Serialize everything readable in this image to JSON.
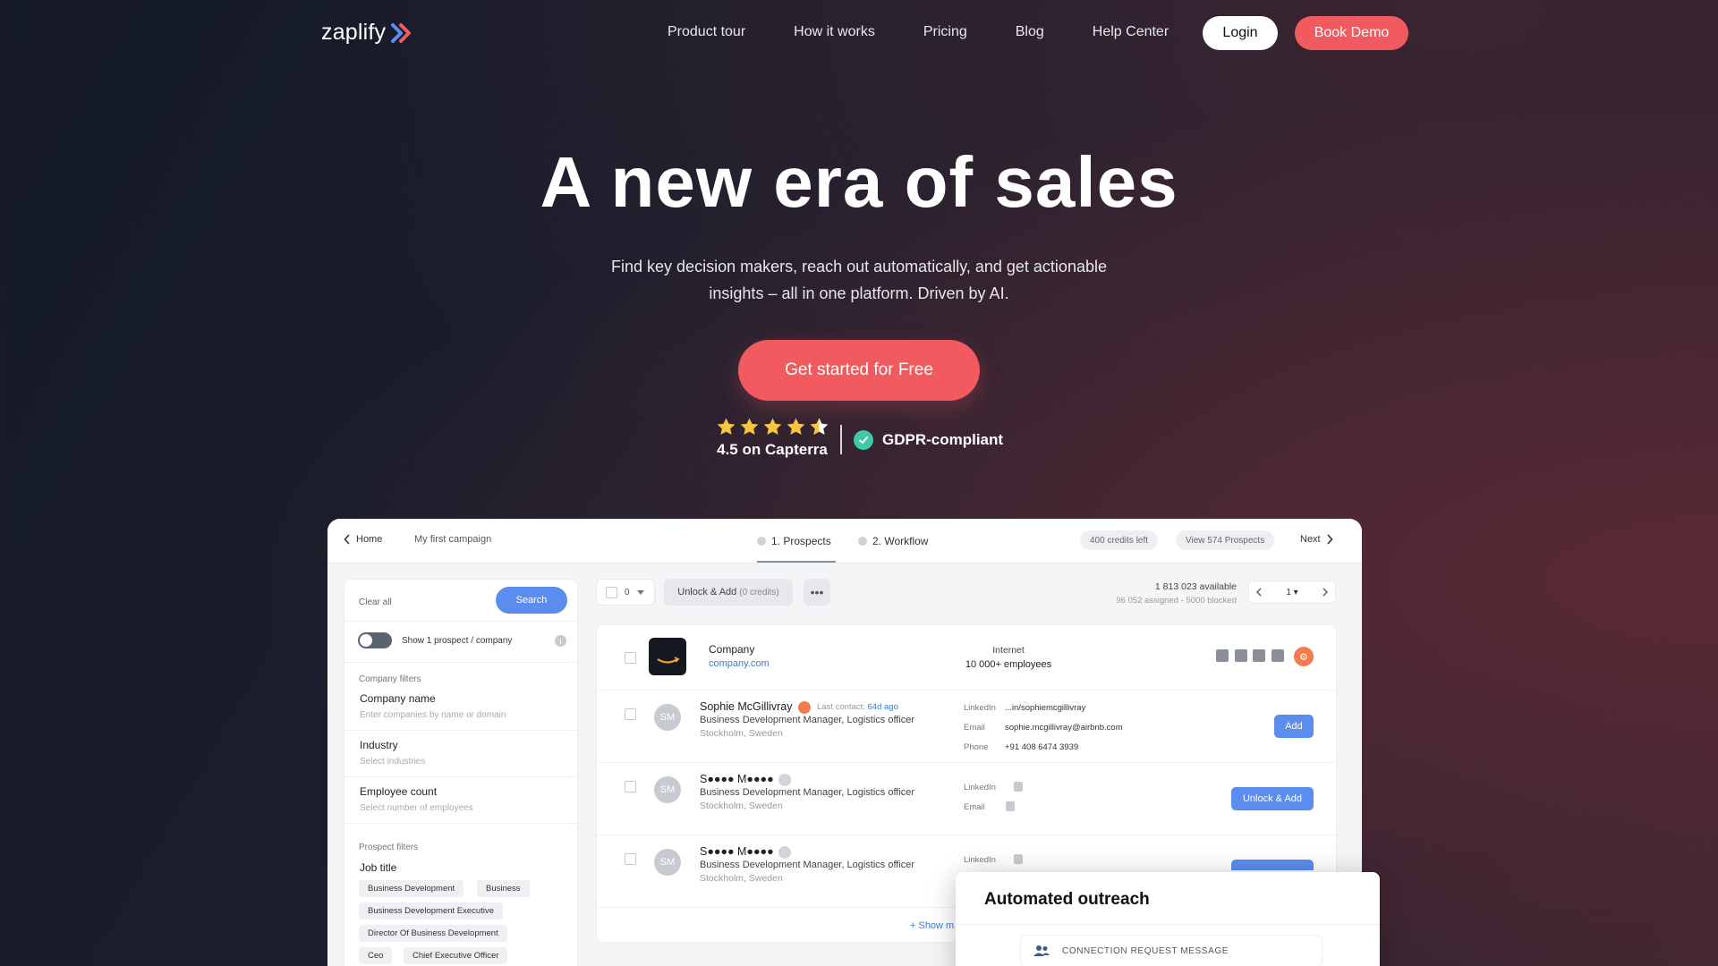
{
  "nav": {
    "logo_text": "zaplify",
    "links": [
      "Product tour",
      "How it works",
      "Pricing",
      "Blog",
      "Help Center"
    ],
    "login_label": "Login",
    "demo_label": "Book Demo"
  },
  "hero": {
    "title": "A new era of sales",
    "subtitle": "Find key decision makers, reach out automatically, and get actionable insights – all in one platform. Driven by AI.",
    "cta_label": "Get started for Free",
    "rating_value": 4.5,
    "rating_max": 5,
    "rating_text": "4.5 on Capterra",
    "gdpr_text": "GDPR-compliant"
  },
  "colors": {
    "accent": "#f15a5e",
    "blue": "#5b8def",
    "gdpr": "#3ec9a7",
    "star": "#f6c543"
  },
  "app": {
    "breadcrumb_home": "Home",
    "breadcrumb_campaign": "My first campaign",
    "step1": "1. Prospects",
    "step2": "2. Workflow",
    "credits": "400 credits left",
    "view_prospects": "View 574 Prospects",
    "next_label": "Next",
    "sidebar": {
      "clear_all": "Clear all",
      "search_label": "Search",
      "show_one": "Show 1 prospect / company",
      "company_filters": "Company filters",
      "company_name_label": "Company name",
      "company_name_ph": "Enter companies by name or domain",
      "industry_label": "Industry",
      "industry_ph": "Select industries",
      "employee_label": "Employee count",
      "employee_ph": "Select number of employees",
      "prospect_filters": "Prospect filters",
      "job_title_label": "Job title",
      "tags": [
        "Business Development",
        "Business",
        "Business Development Executive",
        "Director Of Business Development",
        "Ceo",
        "Chief Executive Officer"
      ]
    },
    "toolbar": {
      "selected_count": "0",
      "unlock_add": "Unlock & Add",
      "unlock_credits": "(0 credits)",
      "more": "•••",
      "available": "1 813 023 available",
      "assigned": "96 052 assigned - 5000 blocked",
      "page": "1"
    },
    "company_row": {
      "label": "Company",
      "link": "company.com",
      "industry": "Internet",
      "employees": "10 000+ employees"
    },
    "prospects": [
      {
        "initials": "SM",
        "name": "Sophie McGillivray",
        "last_contact_label": "Last contact:",
        "last_contact_value": "64d ago",
        "title": "Business Development Manager, Logistics officer",
        "location": "Stockholm, Sweden",
        "linkedin_key": "LinkedIn",
        "linkedin_val": "...in/sophiemcgillivray",
        "email_key": "Email",
        "email_val": "sophie.mcgillivray@airbnb.com",
        "phone_key": "Phone",
        "phone_val": "+91 408 6474 3939",
        "action": "Add"
      },
      {
        "initials": "SM",
        "name": "S●●●● M●●●●",
        "title": "Business Development Manager, Logistics officer",
        "location": "Stockholm, Sweden",
        "linkedin_key": "LinkedIn",
        "email_key": "Email",
        "action": "Unlock & Add"
      },
      {
        "initials": "SM",
        "name": "S●●●● M●●●●",
        "title": "Business Development Manager, Logistics officer",
        "location": "Stockholm, Sweden",
        "linkedin_key": "LinkedIn"
      }
    ],
    "show_more": "+ Show m"
  },
  "outreach": {
    "title": "Automated outreach",
    "connection_label": "CONNECTION REQUEST MESSAGE"
  }
}
